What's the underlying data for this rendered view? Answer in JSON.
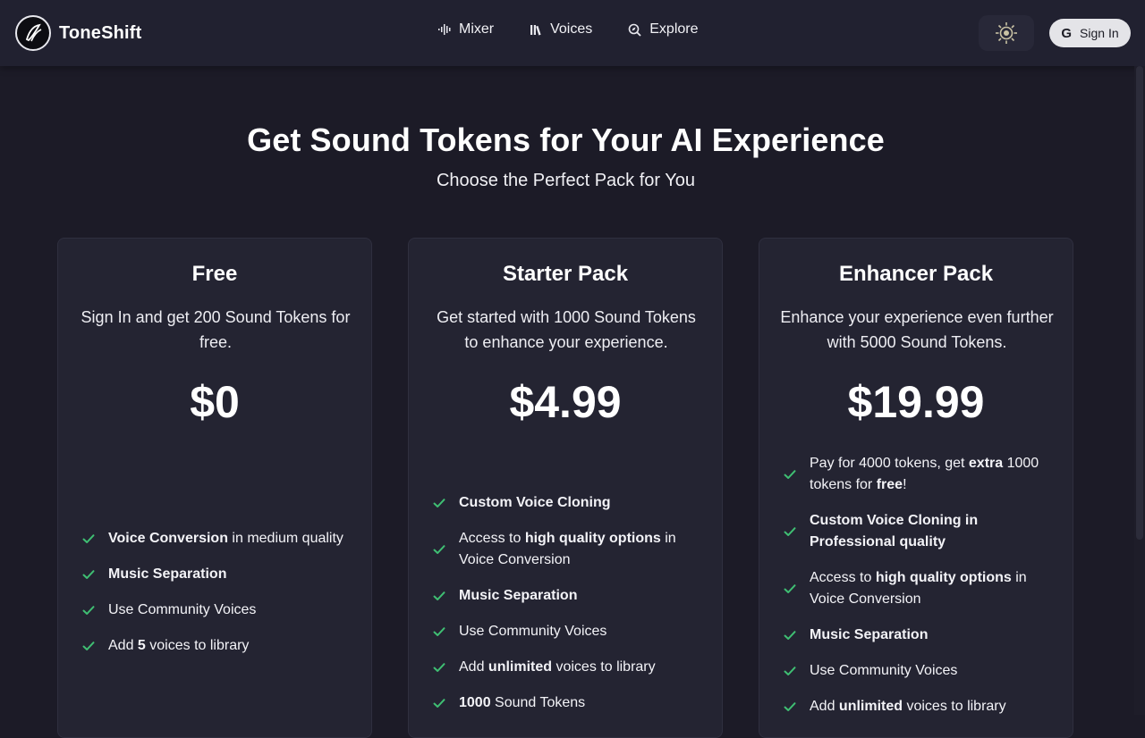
{
  "header": {
    "brand": "ToneShift",
    "nav": [
      {
        "label": "Mixer",
        "icon": "waveform-icon"
      },
      {
        "label": "Voices",
        "icon": "library-icon"
      },
      {
        "label": "Explore",
        "icon": "compass-icon"
      }
    ],
    "theme_icon": "sun-toggle-icon",
    "signin_icon": "G",
    "signin_label": "Sign In"
  },
  "hero": {
    "title": "Get Sound Tokens for Your AI Experience",
    "subtitle": "Choose the Perfect Pack for You"
  },
  "colors": {
    "check": "#3fbf73",
    "background": "#1c1b27",
    "card": "#242432"
  },
  "plans": [
    {
      "name": "Free",
      "description": "Sign In and get 200 Sound Tokens for free.",
      "price": "$0",
      "features": [
        {
          "parts": [
            [
              "Voice Conversion",
              true
            ],
            [
              " in medium quality",
              false
            ]
          ]
        },
        {
          "parts": [
            [
              "Music Separation",
              true
            ]
          ]
        },
        {
          "parts": [
            [
              "Use Community Voices",
              false
            ]
          ]
        },
        {
          "parts": [
            [
              "Add ",
              false
            ],
            [
              "5",
              true
            ],
            [
              " voices to library",
              false
            ]
          ]
        }
      ]
    },
    {
      "name": "Starter Pack",
      "description": "Get started with 1000 Sound Tokens to enhance your experience.",
      "price": "$4.99",
      "features": [
        {
          "parts": [
            [
              "Custom Voice Cloning",
              true
            ]
          ]
        },
        {
          "parts": [
            [
              "Access to ",
              false
            ],
            [
              "high quality options",
              true
            ],
            [
              " in Voice Conversion",
              false
            ]
          ]
        },
        {
          "parts": [
            [
              "Music Separation",
              true
            ]
          ]
        },
        {
          "parts": [
            [
              "Use Community Voices",
              false
            ]
          ]
        },
        {
          "parts": [
            [
              "Add ",
              false
            ],
            [
              "unlimited",
              true
            ],
            [
              " voices to library",
              false
            ]
          ]
        },
        {
          "parts": [
            [
              "1000",
              true
            ],
            [
              " Sound Tokens",
              false
            ]
          ]
        }
      ]
    },
    {
      "name": "Enhancer Pack",
      "description": "Enhance your experience even further with 5000 Sound Tokens.",
      "price": "$19.99",
      "features": [
        {
          "parts": [
            [
              "Pay for 4000 tokens, get ",
              false
            ],
            [
              "extra",
              true
            ],
            [
              " 1000 tokens for ",
              false
            ],
            [
              "free",
              true
            ],
            [
              "!",
              false
            ]
          ]
        },
        {
          "parts": [
            [
              "Custom Voice Cloning in Professional quality",
              true
            ]
          ]
        },
        {
          "parts": [
            [
              "Access to ",
              false
            ],
            [
              "high quality options",
              true
            ],
            [
              " in Voice Conversion",
              false
            ]
          ]
        },
        {
          "parts": [
            [
              "Music Separation",
              true
            ]
          ]
        },
        {
          "parts": [
            [
              "Use Community Voices",
              false
            ]
          ]
        },
        {
          "parts": [
            [
              "Add ",
              false
            ],
            [
              "unlimited",
              true
            ],
            [
              " voices to library",
              false
            ]
          ]
        }
      ]
    }
  ]
}
